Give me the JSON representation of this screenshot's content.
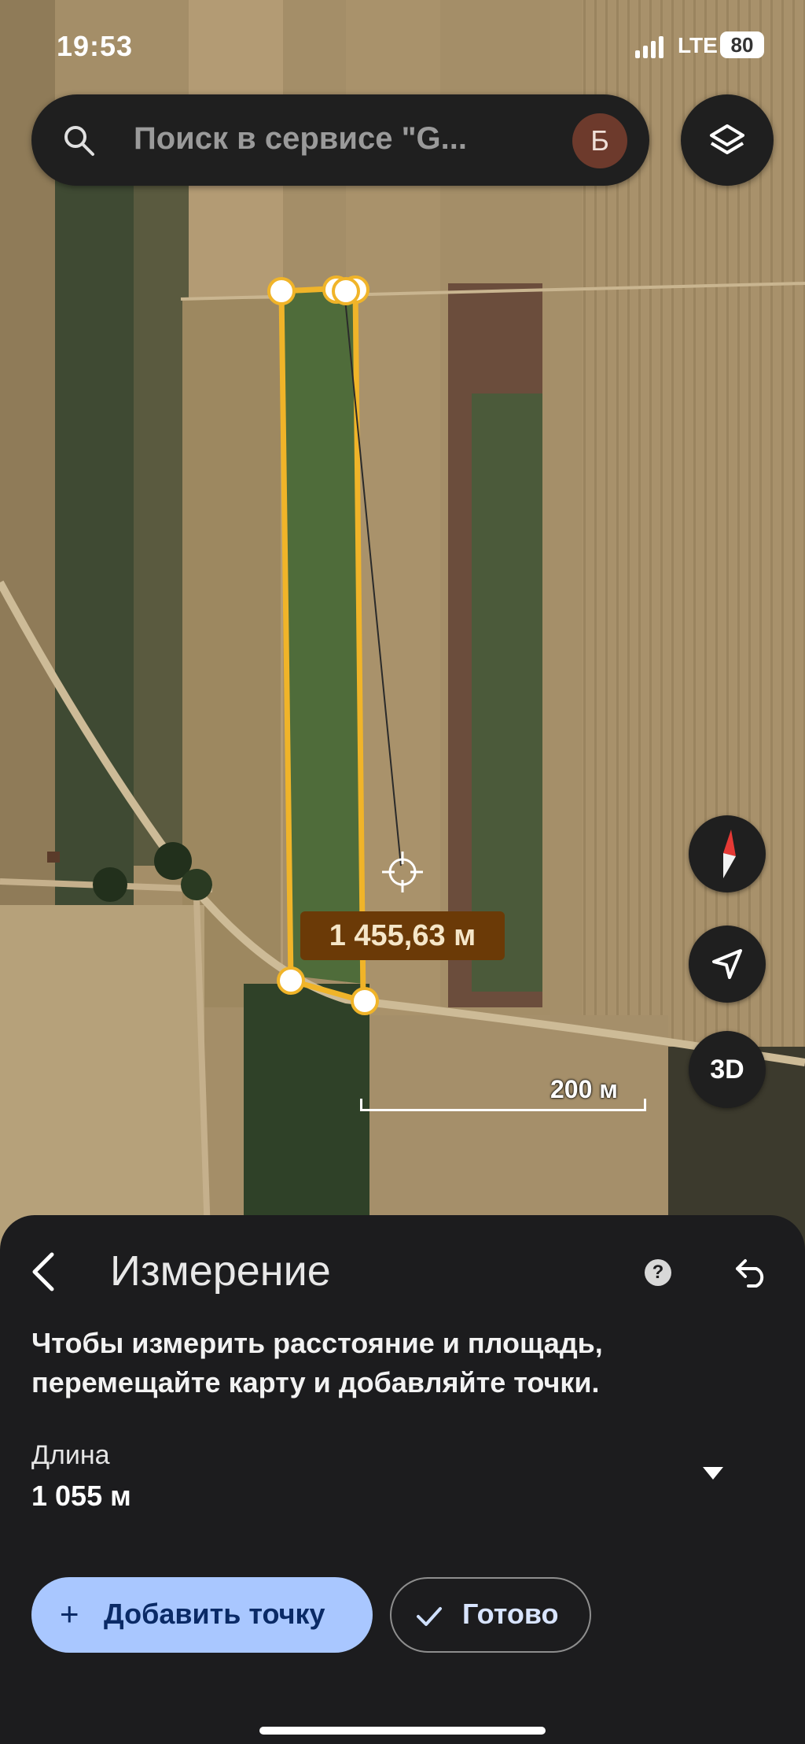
{
  "status_bar": {
    "time": "19:53",
    "network": "LTE",
    "battery": "80"
  },
  "search": {
    "placeholder": "Поиск в сервисе \"G...",
    "avatar_letter": "Б"
  },
  "map": {
    "type": "satellite",
    "measure_label": "1 455,63 м",
    "scale_label": "200 м",
    "btn_3d": "3D",
    "measure_color": "#f0b429"
  },
  "sheet": {
    "title": "Измерение",
    "help": "?",
    "instruction": "Чтобы измерить расстояние и площадь, перемещайте карту и добавляйте точки.",
    "length_label": "Длина",
    "length_value": "1 055 м",
    "add_point": "Добавить точку",
    "done": "Готово",
    "add_point_bg": "#a9c7ff"
  }
}
